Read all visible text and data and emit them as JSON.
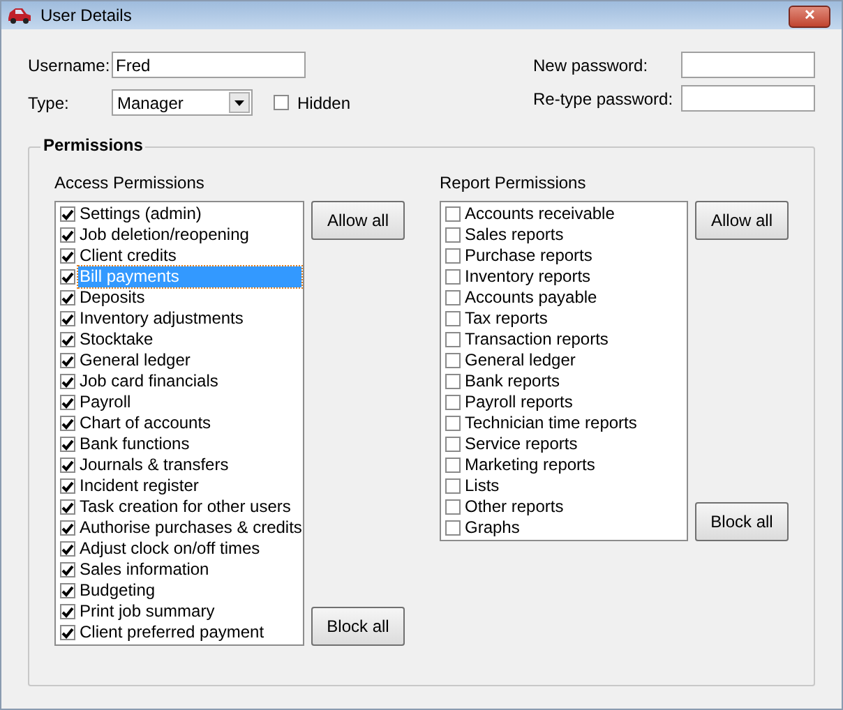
{
  "window": {
    "title": "User Details",
    "close": "✕"
  },
  "username": {
    "label": "Username:",
    "value": "Fred"
  },
  "type": {
    "label": "Type:",
    "value": "Manager"
  },
  "hidden": {
    "label": "Hidden",
    "checked": false
  },
  "new_password": {
    "label": "New password:"
  },
  "retype_password": {
    "label": "Re-type password:"
  },
  "permissions": {
    "title": "Permissions",
    "access": {
      "title": "Access Permissions",
      "allow_button": "Allow all",
      "block_button": "Block all",
      "items": [
        {
          "label": "Settings (admin)",
          "checked": true,
          "selected": false
        },
        {
          "label": "Job deletion/reopening",
          "checked": true,
          "selected": false
        },
        {
          "label": "Client credits",
          "checked": true,
          "selected": false
        },
        {
          "label": "Bill payments",
          "checked": true,
          "selected": true
        },
        {
          "label": "Deposits",
          "checked": true,
          "selected": false
        },
        {
          "label": "Inventory adjustments",
          "checked": true,
          "selected": false
        },
        {
          "label": "Stocktake",
          "checked": true,
          "selected": false
        },
        {
          "label": "General ledger",
          "checked": true,
          "selected": false
        },
        {
          "label": "Job card financials",
          "checked": true,
          "selected": false
        },
        {
          "label": "Payroll",
          "checked": true,
          "selected": false
        },
        {
          "label": "Chart of accounts",
          "checked": true,
          "selected": false
        },
        {
          "label": "Bank functions",
          "checked": true,
          "selected": false
        },
        {
          "label": "Journals & transfers",
          "checked": true,
          "selected": false
        },
        {
          "label": "Incident register",
          "checked": true,
          "selected": false
        },
        {
          "label": "Task creation for other users",
          "checked": true,
          "selected": false
        },
        {
          "label": "Authorise purchases & credits",
          "checked": true,
          "selected": false
        },
        {
          "label": "Adjust clock on/off times",
          "checked": true,
          "selected": false
        },
        {
          "label": "Sales information",
          "checked": true,
          "selected": false
        },
        {
          "label": "Budgeting",
          "checked": true,
          "selected": false
        },
        {
          "label": "Print job summary",
          "checked": true,
          "selected": false
        },
        {
          "label": "Client preferred payment",
          "checked": true,
          "selected": false
        }
      ]
    },
    "report": {
      "title": "Report Permissions",
      "allow_button": "Allow all",
      "block_button": "Block all",
      "items": [
        {
          "label": "Accounts receivable",
          "checked": false,
          "selected": false
        },
        {
          "label": "Sales reports",
          "checked": false,
          "selected": false
        },
        {
          "label": "Purchase reports",
          "checked": false,
          "selected": false
        },
        {
          "label": "Inventory reports",
          "checked": false,
          "selected": false
        },
        {
          "label": "Accounts payable",
          "checked": false,
          "selected": false
        },
        {
          "label": "Tax reports",
          "checked": false,
          "selected": false
        },
        {
          "label": "Transaction reports",
          "checked": false,
          "selected": false
        },
        {
          "label": "General ledger",
          "checked": false,
          "selected": false
        },
        {
          "label": "Bank reports",
          "checked": false,
          "selected": false
        },
        {
          "label": "Payroll reports",
          "checked": false,
          "selected": false
        },
        {
          "label": "Technician time reports",
          "checked": false,
          "selected": false
        },
        {
          "label": "Service reports",
          "checked": false,
          "selected": false
        },
        {
          "label": "Marketing reports",
          "checked": false,
          "selected": false
        },
        {
          "label": "Lists",
          "checked": false,
          "selected": false
        },
        {
          "label": "Other reports",
          "checked": false,
          "selected": false
        },
        {
          "label": "Graphs",
          "checked": false,
          "selected": false
        }
      ]
    }
  }
}
